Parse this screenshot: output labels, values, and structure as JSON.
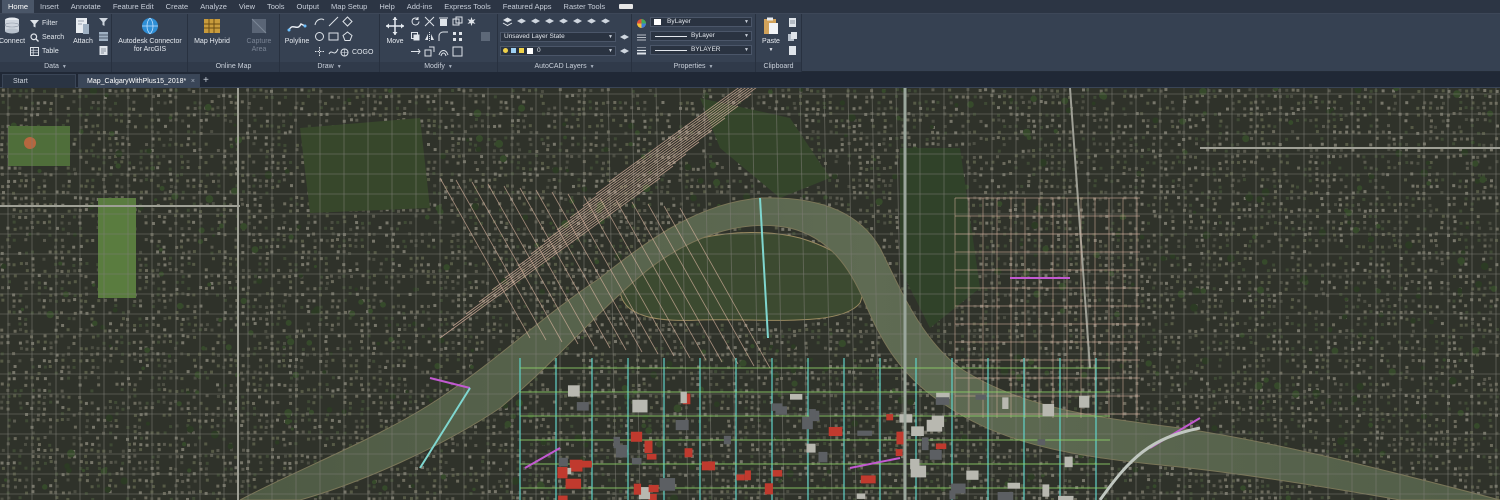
{
  "menu_tabs": [
    "Home",
    "Insert",
    "Annotate",
    "Feature Edit",
    "Create",
    "Analyze",
    "View",
    "Tools",
    "Output",
    "Map Setup",
    "Help",
    "Add-ins",
    "Express Tools",
    "Featured Apps",
    "Raster Tools"
  ],
  "active_tab": "Home",
  "ribbon": {
    "connect": "Connect",
    "filter": "Filter",
    "search": "Search",
    "table": "Table",
    "attach": "Attach",
    "data_panel": "Data",
    "connector": "Autodesk Connector",
    "connector_line2": "for ArcGIS",
    "map_hybrid": "Map Hybrid",
    "capture": "Capture",
    "capture_line2": "Area",
    "online_map_panel": "Online Map",
    "polyline": "Polyline",
    "cogo": "COGO",
    "draw_panel": "Draw",
    "move": "Move",
    "modify_panel": "Modify",
    "layer_state": "Unsaved Layer State",
    "layer_name": "0",
    "layers_panel": "AutoCAD Layers",
    "color_value": "ByLayer",
    "linetype_value": "ByLayer",
    "lineweight_value": "BYLAYER",
    "properties_panel": "Properties",
    "paste": "Paste",
    "clipboard_panel": "Clipboard"
  },
  "doc_tabs": {
    "start": "Start",
    "drawing": "Map_CalgaryWithPlus15_2018*",
    "add": "+"
  },
  "colors": {
    "river": "#5a6a4f",
    "parcel_outline": "#d9b3a0",
    "street_cyan": "#5fd3c9",
    "street_magenta": "#c25ad1",
    "street_green": "#8fd46a",
    "roof_red": "#c03a2e"
  }
}
